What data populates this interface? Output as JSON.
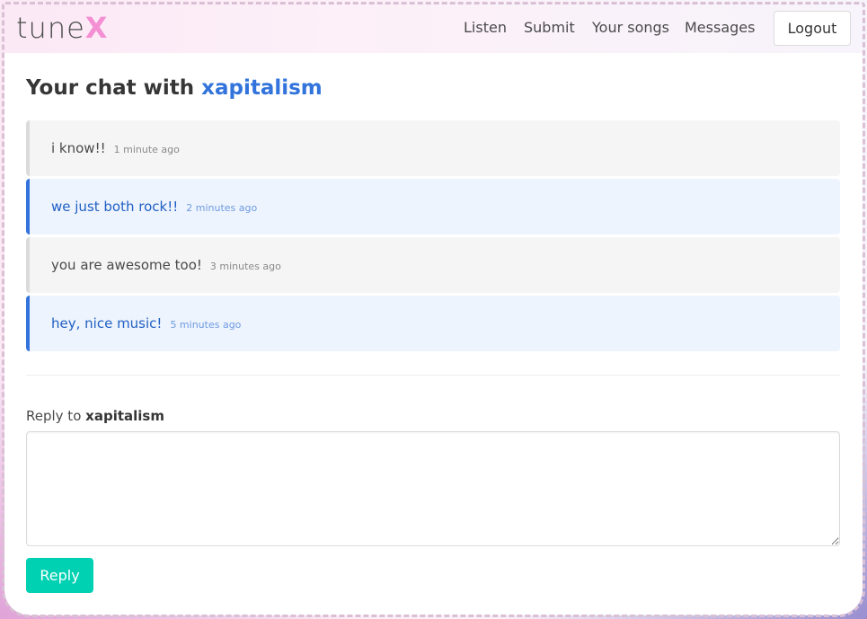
{
  "brand": {
    "name_main": "tune",
    "name_accent": "X"
  },
  "nav": {
    "items": [
      {
        "label": "Listen"
      },
      {
        "label": "Submit"
      },
      {
        "label": "Your songs"
      },
      {
        "label": "Messages"
      }
    ],
    "logout_label": "Logout"
  },
  "page": {
    "title_prefix": "Your chat with",
    "partner": "xapitalism"
  },
  "messages": [
    {
      "text": "i know!!",
      "time": "1 minute ago",
      "mine": false
    },
    {
      "text": "we just both rock!!",
      "time": "2 minutes ago",
      "mine": true
    },
    {
      "text": "you are awesome too!",
      "time": "3 minutes ago",
      "mine": false
    },
    {
      "text": "hey, nice music!",
      "time": "5 minutes ago",
      "mine": true
    }
  ],
  "reply": {
    "label_prefix": "Reply to",
    "recipient": "xapitalism",
    "textarea_value": "",
    "button_label": "Reply"
  },
  "colors": {
    "accent": "#3273dc",
    "primary_button": "#00d1b2",
    "logo_accent": "#f48fd4"
  }
}
